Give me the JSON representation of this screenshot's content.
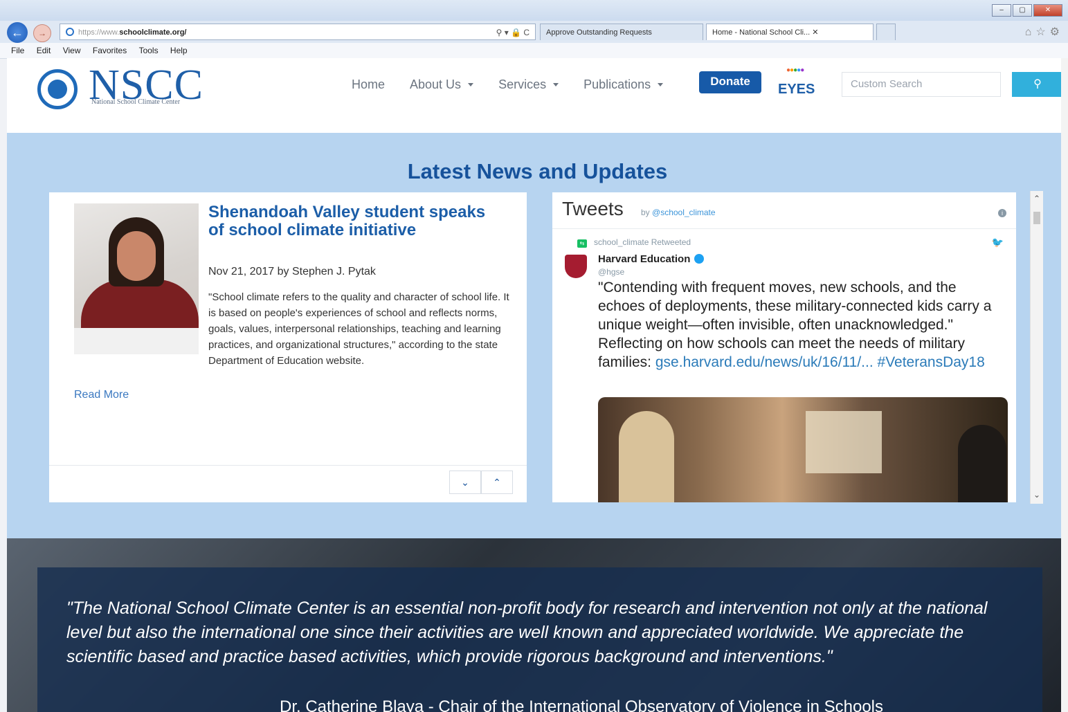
{
  "browser": {
    "url_prefix": "https://www.",
    "url_host": "schoolclimate.org/",
    "address_tools": "⚲ ▾ 🔒 C",
    "tabs": [
      {
        "label": "Approve Outstanding Requests"
      },
      {
        "label": "Home - National School Cli...  ✕"
      }
    ],
    "menu": [
      "File",
      "Edit",
      "View",
      "Favorites",
      "Tools",
      "Help"
    ],
    "window_controls": [
      "–",
      "▢",
      "✕"
    ]
  },
  "header": {
    "logo_text": "NSCC",
    "logo_tagline": "National School Climate Center",
    "nav": [
      {
        "label": "Home",
        "dropdown": false
      },
      {
        "label": "About Us",
        "dropdown": true
      },
      {
        "label": "Services",
        "dropdown": true
      },
      {
        "label": "Publications",
        "dropdown": true
      }
    ],
    "donate_label": "Donate",
    "eyes_label": "EYES",
    "search_placeholder": "Custom Search"
  },
  "news": {
    "section_title": "Latest News and Updates",
    "headline": "Shenandoah Valley student speaks of school climate initiative",
    "meta": "Nov 21, 2017 by Stephen J. Pytak",
    "excerpt": "\"School climate refers to the quality and character of school life. It is based on people's experiences of school and reflects norms, goals, values, interpersonal relationships, teaching and learning practices, and organizational structures,\" according to the state Department of Education website.",
    "read_more": "Read More",
    "pager_down": "⌄",
    "pager_up": "⌃"
  },
  "tweets": {
    "title": "Tweets",
    "by_prefix": "by ",
    "by_handle": "@school_climate",
    "retweet_text": "school_climate Retweeted",
    "author": "Harvard Education",
    "handle": "@hgse",
    "text": "\"Contending with frequent moves, new schools, and the echoes of deployments, these military-connected kids carry a unique weight—often invisible, often unacknowledged.\" Reflecting on how schools can meet the needs of military families:",
    "links": "gse.harvard.edu/news/uk/16/11/... #VeteransDay18"
  },
  "testimonial": {
    "quote": "\"The National School Climate Center is an essential non-profit body for research and intervention not only at the national level but also the international one since their activities are well known and appreciated worldwide. We appreciate the scientific based and practice based activities, which provide rigorous background and interventions.\"",
    "attribution": "Dr. Catherine Blaya - Chair of the International Observatory of Violence in Schools"
  }
}
